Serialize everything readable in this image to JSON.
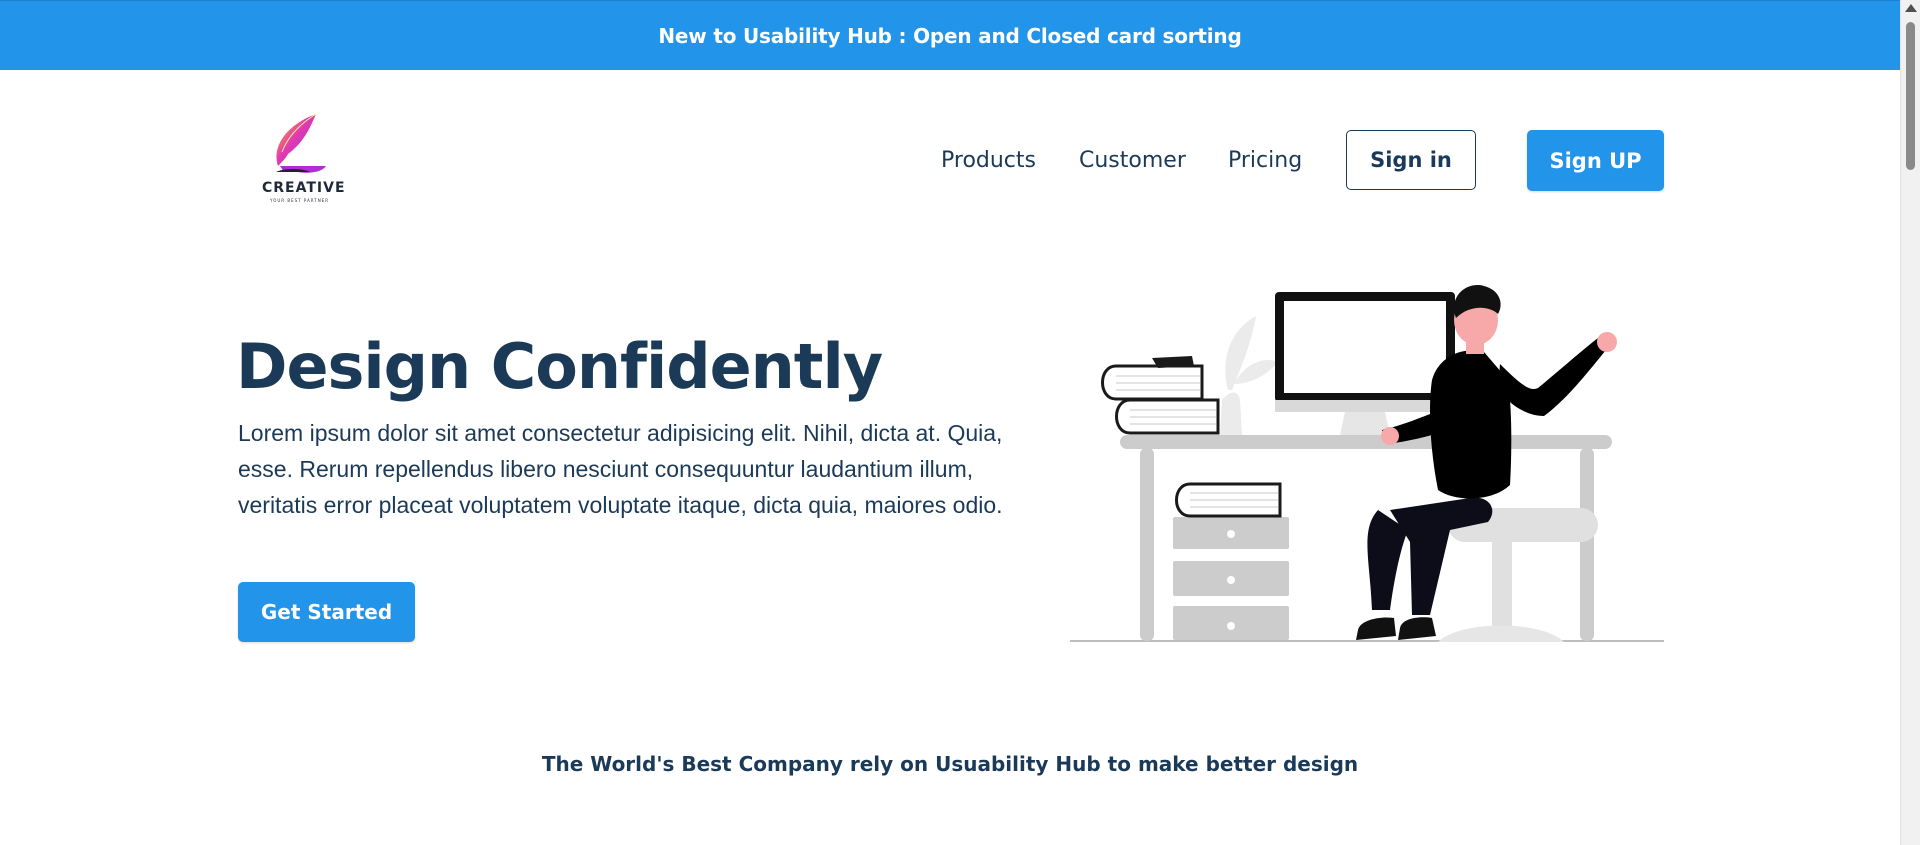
{
  "announcement": {
    "text": "New to Usability Hub : Open and Closed card sorting"
  },
  "logo": {
    "brand": "CREATIVE",
    "tagline": "YOUR BEST PARTNER"
  },
  "nav": {
    "links": [
      "Products",
      "Customer",
      "Pricing"
    ],
    "signin_label": "Sign in",
    "signup_label": "Sign UP"
  },
  "hero": {
    "title": "Design Confidently",
    "text": "Lorem ipsum dolor sit amet consectetur adipisicing elit. Nihil, dicta at. Quia, esse. Rerum repellendus libero nesciunt consequuntur laudantium illum, veritatis error placeat voluptatem voluptate itaque, dicta quia, maiores odio.",
    "cta_label": "Get Started"
  },
  "companies": {
    "tagline": "The World's Best Company rely on Usuability Hub to make better design"
  },
  "colors": {
    "brand_blue": "#2294ea",
    "navy_text": "#1b3a57"
  },
  "icons": {
    "logo": "feather-logo-icon",
    "illustration": "person-at-desk-illustration"
  }
}
